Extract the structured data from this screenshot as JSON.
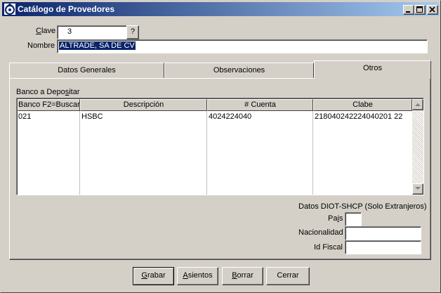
{
  "window": {
    "title": "Catálogo de Provedores",
    "controls": {
      "minimize_icon": "minimize-icon",
      "maximize_icon": "maximize-icon",
      "close_icon": "close-icon"
    }
  },
  "header": {
    "clave_label_ul": "C",
    "clave_label_rest": "lave",
    "clave_value": "3",
    "lookup_button": "?",
    "nombre_label": "Nombre",
    "nombre_value": "ALTRADE, SA DE CV"
  },
  "tabs": [
    {
      "label": "Datos Generales",
      "active": false
    },
    {
      "label": "Observaciones",
      "active": false
    },
    {
      "label": "Otros",
      "active": true
    }
  ],
  "otros": {
    "section_label_pre": "Banco a Depo",
    "section_label_ul": "s",
    "section_label_post": "itar",
    "table": {
      "columns": [
        "Banco F2=Buscar",
        "Descripción",
        "# Cuenta",
        "Clabe"
      ],
      "rows": [
        {
          "banco": "021",
          "descripcion": "HSBC",
          "cuenta": "4024224040",
          "clabe": "218040242224040201 22"
        }
      ]
    },
    "diot_title": "Datos DIOT-SHCP (Solo Extranjeros)",
    "pais_label_pre": "Pa",
    "pais_label_ul": "i",
    "pais_label_post": "s",
    "pais_value": "",
    "nacionalidad_label": "Nacionalidad",
    "nacionalidad_value": "",
    "idfiscal_label": "Id Fiscal",
    "idfiscal_value": ""
  },
  "buttons": {
    "grabar_ul": "G",
    "grabar_rest": "rabar",
    "asientos_ul": "A",
    "asientos_rest": "sientos",
    "borrar_ul": "B",
    "borrar_rest": "orrar",
    "cerrar": "Cerrar"
  }
}
